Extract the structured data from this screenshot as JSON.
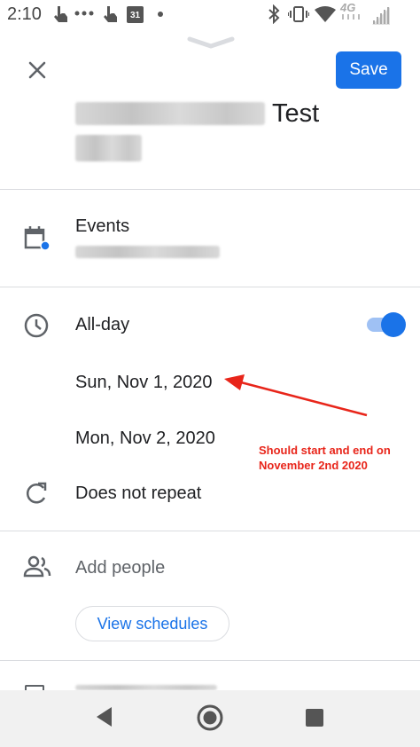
{
  "status_bar": {
    "time": "2:10",
    "calendar_day": "31",
    "network": "4G",
    "icons": [
      "touch-icon",
      "dots-icon",
      "touch-icon",
      "calendar-icon",
      "dot-icon",
      "bluetooth-icon",
      "vibrate-icon",
      "wifi-icon",
      "lte-icon",
      "signal-icon"
    ]
  },
  "header": {
    "close_icon": "close-icon",
    "save_label": "Save"
  },
  "event": {
    "title": "Test"
  },
  "calendar": {
    "label": "Events",
    "icon": "calendar-icon",
    "accent_color": "#1a73e8"
  },
  "time": {
    "all_day_label": "All-day",
    "all_day_on": true,
    "start_date": "Sun, Nov 1, 2020",
    "end_date": "Mon, Nov 2, 2020",
    "repeat_label": "Does not repeat"
  },
  "annotation": {
    "text": "Should start and end on November 2nd 2020",
    "color": "#e8251a"
  },
  "people": {
    "add_placeholder": "Add people",
    "view_schedules_label": "View schedules"
  },
  "nav_bar": {
    "icons": [
      "back-icon",
      "home-icon",
      "recents-icon"
    ]
  },
  "colors": {
    "primary": "#1a73e8",
    "divider": "#dadce0",
    "text": "#202124",
    "secondary_text": "#5f6368"
  }
}
